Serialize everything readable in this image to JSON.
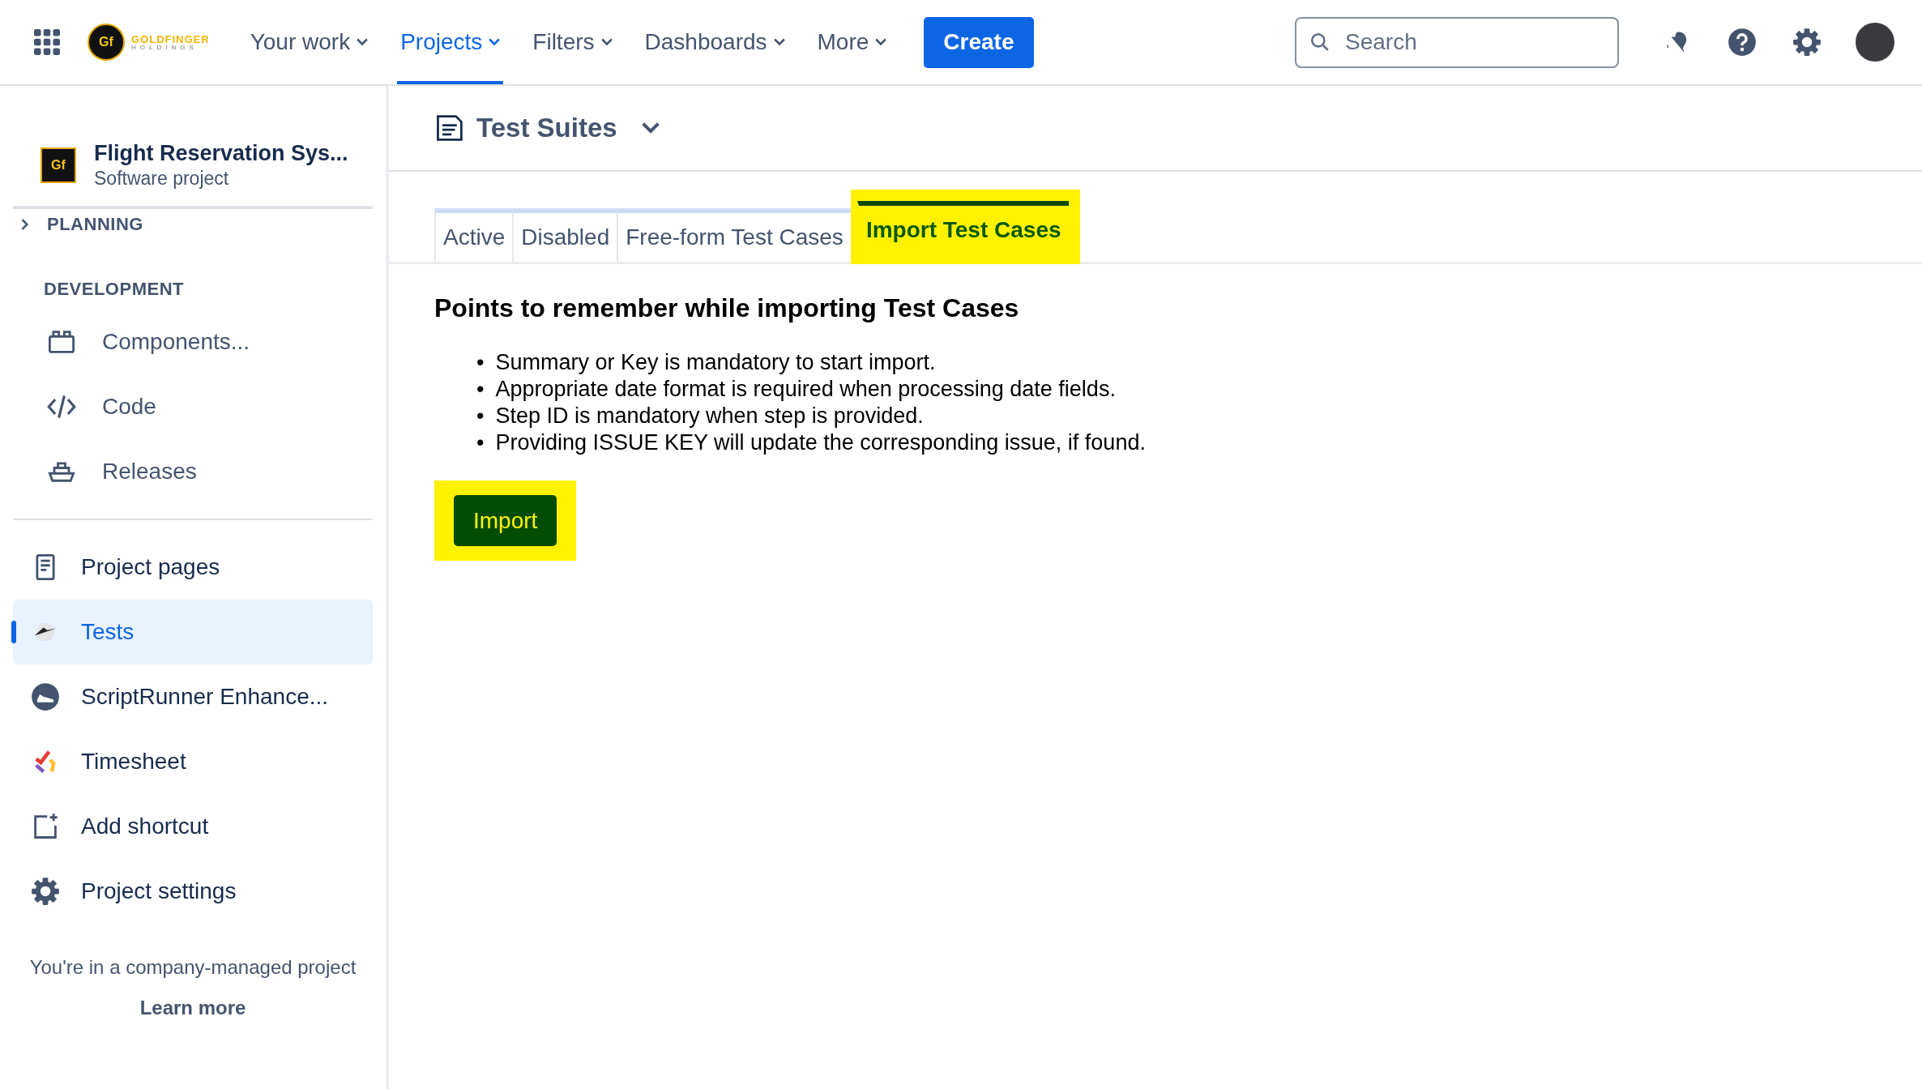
{
  "logo": {
    "mark": "Gf",
    "name": "GOLDFINGER",
    "tagline": "HOLDINGS"
  },
  "nav": [
    {
      "label": "Your work",
      "selected": false
    },
    {
      "label": "Projects",
      "selected": true
    },
    {
      "label": "Filters",
      "selected": false
    },
    {
      "label": "Dashboards",
      "selected": false
    },
    {
      "label": "More",
      "selected": false
    }
  ],
  "create_button": "Create",
  "search": {
    "placeholder": "Search"
  },
  "project": {
    "mark": "Gf",
    "name": "Flight Reservation Sys...",
    "type": "Software project"
  },
  "sidebar": {
    "planning": {
      "title": "PLANNING",
      "expanded": false
    },
    "development": {
      "title": "DEVELOPMENT",
      "items": [
        {
          "label": "Components...",
          "selected": false
        },
        {
          "label": "Code",
          "selected": false
        },
        {
          "label": "Releases",
          "selected": false
        }
      ]
    },
    "items": [
      {
        "label": "Project pages",
        "selected": false
      },
      {
        "label": "Tests",
        "selected": true
      },
      {
        "label": "ScriptRunner Enhance...",
        "selected": false
      },
      {
        "label": "Timesheet",
        "selected": false
      },
      {
        "label": "Add shortcut",
        "selected": false
      },
      {
        "label": "Project settings",
        "selected": false
      }
    ],
    "footer": "You're in a company-managed project",
    "footer_link": "Learn more"
  },
  "page_title": "Test Suites",
  "tabs": [
    {
      "label": "Active",
      "selected": false,
      "highlighted": false
    },
    {
      "label": "Disabled",
      "selected": false,
      "highlighted": false
    },
    {
      "label": "Free-form Test Cases",
      "selected": false,
      "highlighted": false
    },
    {
      "label": "Import Test Cases",
      "selected": true,
      "highlighted": true
    }
  ],
  "heading": "Points to remember while importing Test Cases",
  "points": [
    {
      "marker": "•",
      "text": "Summary or Key is mandatory to start import."
    },
    {
      "marker": "•",
      "text": "Appropriate date format is required when processing date fields."
    },
    {
      "marker": "•",
      "text": "Step ID is mandatory when step is provided."
    },
    {
      "marker": "•",
      "text": "Providing ISSUE KEY will update the corresponding issue, if found."
    }
  ],
  "import_button": {
    "label": "Import",
    "highlighted": true
  }
}
